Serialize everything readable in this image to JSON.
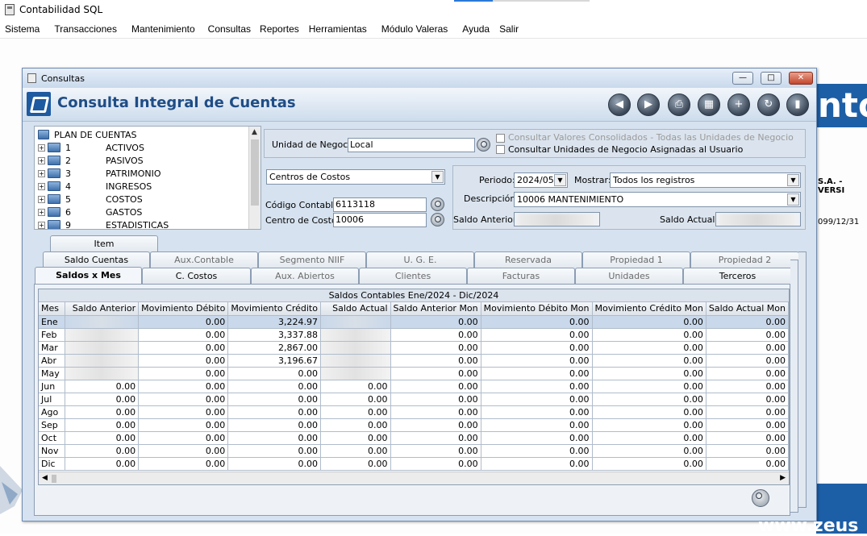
{
  "app": {
    "title": "Contabilidad SQL",
    "menu": [
      "Sistema",
      "Transacciones",
      "Mantenimiento",
      "Consultas",
      "Reportes",
      "Herramientas",
      "Módulo Valeras",
      "Ayuda",
      "Salir"
    ],
    "background": {
      "brand_fragment": "nto",
      "company_fragment": "S.A. - VERSI",
      "date_fragment": "099/12/31",
      "url_fragment": "www.zeus"
    }
  },
  "window": {
    "title": "Consultas",
    "header_title": "Consulta Integral de Cuentas",
    "toolbar_icons": [
      "previous-icon",
      "next-icon",
      "print-icon",
      "calculator-icon",
      "new-document-icon",
      "refresh-icon",
      "exit-icon"
    ]
  },
  "tree": {
    "root": "PLAN DE CUENTAS",
    "items": [
      {
        "code": "1",
        "name": "ACTIVOS"
      },
      {
        "code": "2",
        "name": "PASIVOS"
      },
      {
        "code": "3",
        "name": "PATRIMONIO"
      },
      {
        "code": "4",
        "name": "INGRESOS"
      },
      {
        "code": "5",
        "name": "COSTOS"
      },
      {
        "code": "6",
        "name": "GASTOS"
      },
      {
        "code": "9",
        "name": "ESTADISTICAS"
      }
    ]
  },
  "filters": {
    "unidad_negocio_label": "Unidad de Negocio",
    "unidad_negocio_value": "Local",
    "consolidados_label": "Consultar Valores Consolidados - Todas las Unidades de Negocio",
    "asignadas_label": "Consultar Unidades de Negocio Asignadas al Usuario",
    "tipo_select": "Centros de Costos",
    "codigo_contable_label": "Código Contable:",
    "codigo_contable_value": "6113118",
    "centro_costo_label": "Centro de Costo:",
    "centro_costo_value": "10006",
    "periodo_label": "Periodo:",
    "periodo_value": "2024/05",
    "mostrar_label": "Mostrar:",
    "mostrar_value": "Todos los registros",
    "descripcion_label": "Descripción:",
    "descripcion_value": "10006  MANTENIMIENTO",
    "saldo_anterior_label": "Saldo Anterior:",
    "saldo_actual_label": "Saldo Actual:"
  },
  "tabs": {
    "row1": [
      "Item"
    ],
    "row2": [
      "Saldo Cuentas",
      "Aux.Contable",
      "Segmento NIIF",
      "U. G. E.",
      "Reservada",
      "Propiedad 1",
      "Propiedad 2"
    ],
    "row3": [
      "Saldos x Mes",
      "C. Costos",
      "Aux. Abiertos",
      "Clientes",
      "Facturas",
      "Unidades",
      "Terceros"
    ],
    "selected": "Saldos x Mes"
  },
  "grid": {
    "caption": "Saldos Contables  Ene/2024 - Dic/2024",
    "columns": [
      "Mes",
      "Saldo Anterior",
      "Movimiento Débito",
      "Movimiento Crédito",
      "Saldo Actual",
      "Saldo Anterior Mon",
      "Movimiento Débito Mon",
      "Movimiento Crédito Mon",
      "Saldo Actual Mon"
    ],
    "rows": [
      [
        "Ene",
        "",
        "0.00",
        "3,224.97",
        "",
        "0.00",
        "0.00",
        "0.00",
        "0.00"
      ],
      [
        "Feb",
        "",
        "0.00",
        "3,337.88",
        "",
        "0.00",
        "0.00",
        "0.00",
        "0.00"
      ],
      [
        "Mar",
        "",
        "0.00",
        "2,867.00",
        "",
        "0.00",
        "0.00",
        "0.00",
        "0.00"
      ],
      [
        "Abr",
        "",
        "0.00",
        "3,196.67",
        "",
        "0.00",
        "0.00",
        "0.00",
        "0.00"
      ],
      [
        "May",
        "",
        "0.00",
        "0.00",
        "",
        "0.00",
        "0.00",
        "0.00",
        "0.00"
      ],
      [
        "Jun",
        "0.00",
        "0.00",
        "0.00",
        "0.00",
        "0.00",
        "0.00",
        "0.00",
        "0.00"
      ],
      [
        "Jul",
        "0.00",
        "0.00",
        "0.00",
        "0.00",
        "0.00",
        "0.00",
        "0.00",
        "0.00"
      ],
      [
        "Ago",
        "0.00",
        "0.00",
        "0.00",
        "0.00",
        "0.00",
        "0.00",
        "0.00",
        "0.00"
      ],
      [
        "Sep",
        "0.00",
        "0.00",
        "0.00",
        "0.00",
        "0.00",
        "0.00",
        "0.00",
        "0.00"
      ],
      [
        "Oct",
        "0.00",
        "0.00",
        "0.00",
        "0.00",
        "0.00",
        "0.00",
        "0.00",
        "0.00"
      ],
      [
        "Nov",
        "0.00",
        "0.00",
        "0.00",
        "0.00",
        "0.00",
        "0.00",
        "0.00",
        "0.00"
      ],
      [
        "Dic",
        "0.00",
        "0.00",
        "0.00",
        "0.00",
        "0.00",
        "0.00",
        "0.00",
        "0.00"
      ]
    ],
    "selected_row": "Ene"
  },
  "colors": {
    "accent": "#1f4d86",
    "selection": "#c9d8ea",
    "window_bg": "#d6e2ef"
  }
}
